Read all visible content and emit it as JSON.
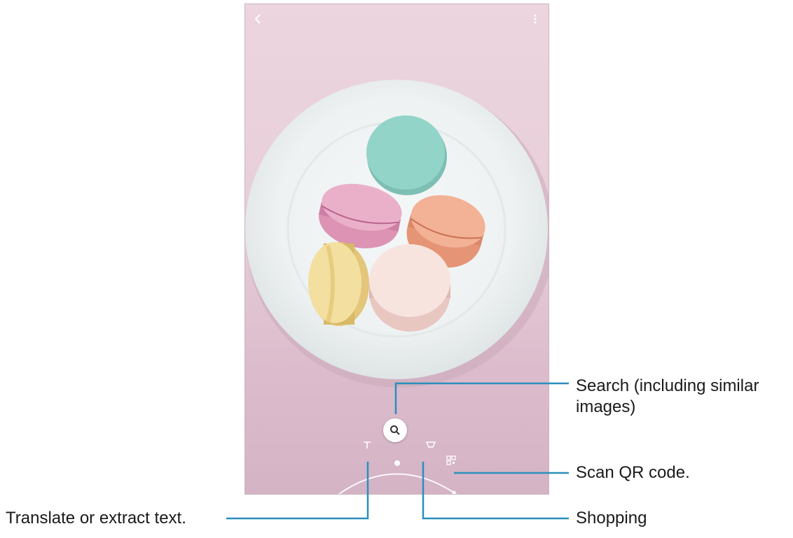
{
  "callouts": {
    "search": "Search (including similar",
    "search_line2": "images)",
    "scan_qr": "Scan QR code.",
    "translate": "Translate or extract text.",
    "shopping": "Shopping"
  },
  "colors": {
    "accent": "#2a8fbd",
    "background": "#e8cfda",
    "macaron_mint": "#8ecfc3",
    "macaron_pink": "#e9a9c6",
    "macaron_peach": "#f0a888",
    "macaron_yellow": "#f1dc9a",
    "macaron_cream": "#f5ddd8"
  },
  "icons": {
    "back": "back-arrow-icon",
    "more": "more-options-icon",
    "search": "search-icon",
    "text": "text-mode-icon",
    "shopping": "shopping-cart-icon",
    "qr": "qr-code-icon"
  }
}
